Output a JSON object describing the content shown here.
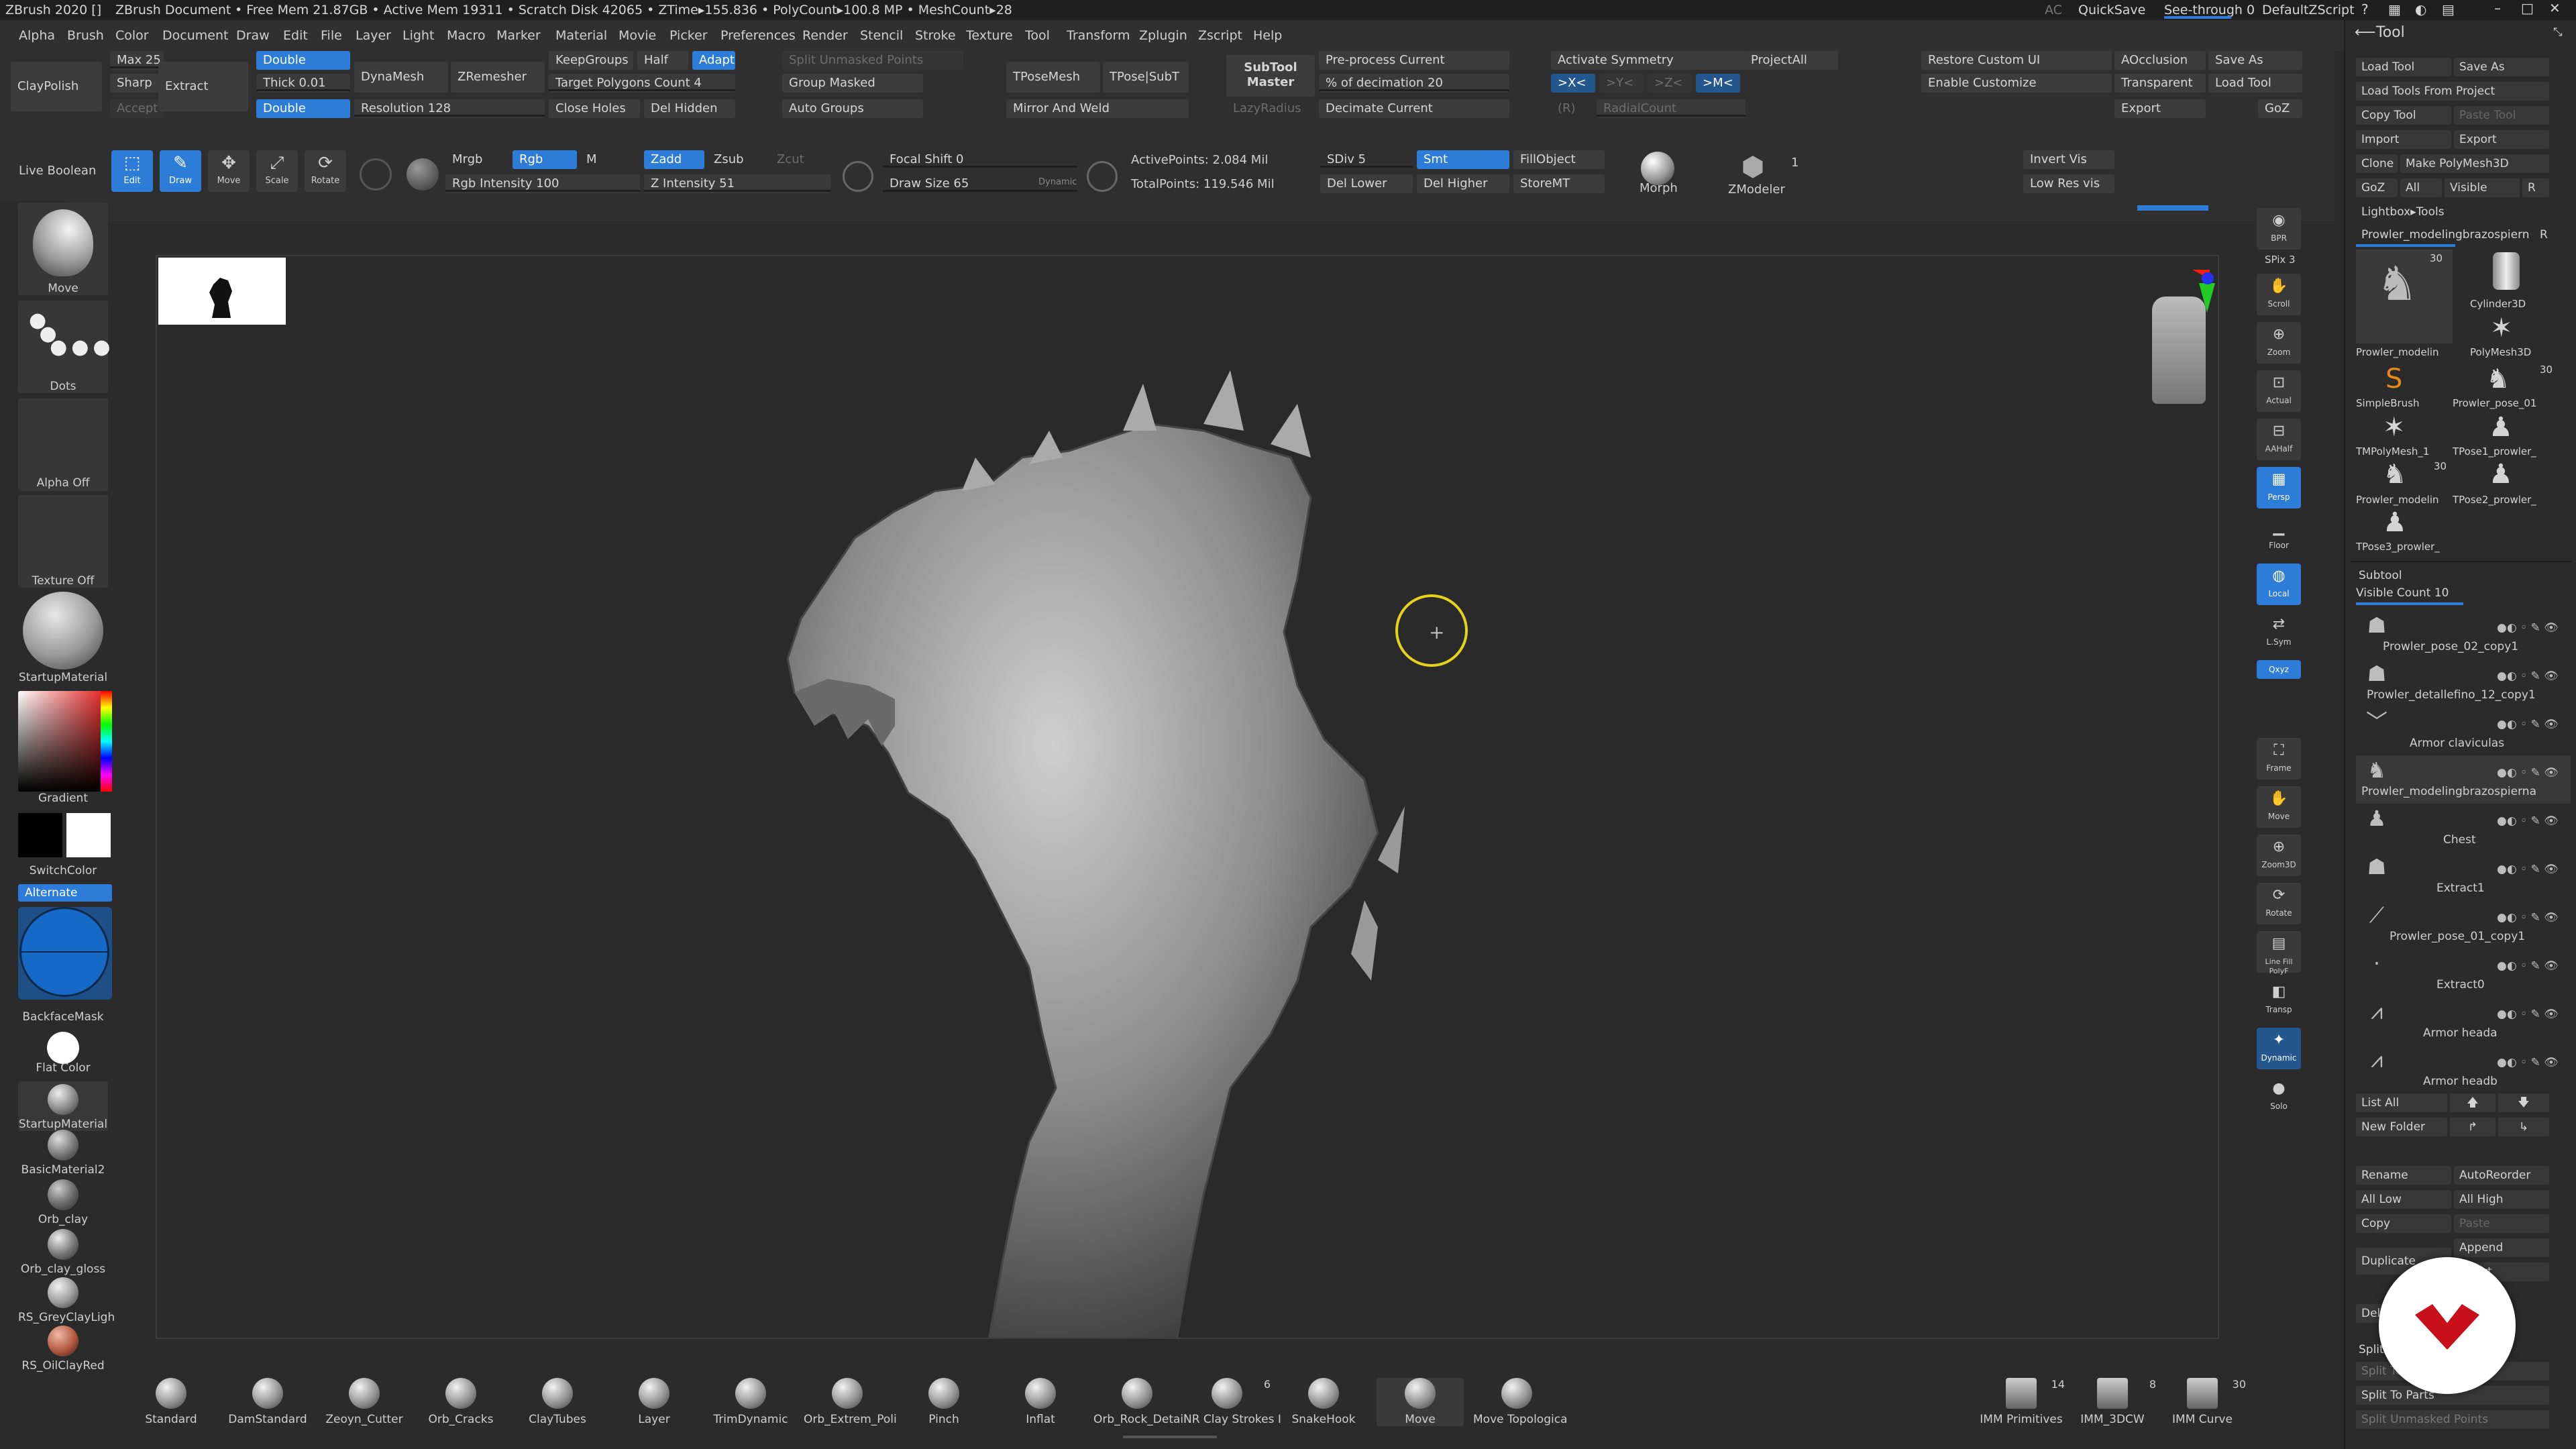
{
  "titlebar": {
    "app": "ZBrush 2020 []",
    "document": "ZBrush Document",
    "stats": "• Free Mem 21.87GB • Active Mem 19311 • Scratch Disk 42065 • ZTime▸155.836 • PolyCount▸100.8 MP • MeshCount▸28",
    "ac": "AC",
    "quicksave": "QuickSave",
    "seethrough": "See-through  0",
    "script": "DefaultZScript"
  },
  "menus": [
    "Alpha",
    "Brush",
    "Color",
    "Document",
    "Draw",
    "Edit",
    "File",
    "Layer",
    "Light",
    "Macro",
    "Marker",
    "Material",
    "Movie",
    "Picker",
    "Preferences",
    "Render",
    "Stencil",
    "Stroke",
    "Texture",
    "Tool",
    "Transform",
    "Zplugin",
    "Zscript",
    "Help"
  ],
  "toolbar": {
    "claypolish": "ClayPolish",
    "max": "Max 25",
    "sharp": "Sharp",
    "accept": "Accept",
    "extract": "Extract",
    "double1": "Double",
    "thick": "Thick 0.01",
    "double2": "Double",
    "dynamesh": "DynaMesh",
    "resolution": "Resolution 128",
    "zremesher": "ZRemesher",
    "keepgroups": "KeepGroups",
    "half": "Half",
    "adapt": "Adapt",
    "target_polygons": "Target Polygons Count 4",
    "close_holes": "Close Holes",
    "del_hidden": "Del Hidden",
    "split_unmasked": "Split Unmasked Points",
    "group_masked": "Group Masked",
    "auto_groups": "Auto Groups",
    "tposemesh": "TPoseMesh",
    "tpose_subt": "TPose|SubT",
    "mirror_weld": "Mirror And Weld",
    "subtool_master": "SubTool Master",
    "lazyradius": "LazyRadius",
    "preprocess": "Pre-process Current",
    "decimation": "% of decimation 20",
    "decimate_current": "Decimate Current",
    "activate_symmetry": "Activate Symmetry",
    "sym_x": ">X<",
    "sym_y": ">Y<",
    "sym_z": ">Z<",
    "sym_m": ">M<",
    "sym_r": "(R)",
    "radialcount": "RadialCount",
    "projectall": "ProjectAll",
    "restore_custom_ui": "Restore Custom UI",
    "enable_customize": "Enable Customize",
    "aocclusion": "AOcclusion",
    "transparent": "Transparent",
    "export": "Export",
    "save_as": "Save As",
    "load_tool": "Load Tool",
    "goz": "GoZ",
    "live_boolean": "Live Boolean",
    "edit": "Edit",
    "draw": "Draw",
    "move": "Move",
    "scale": "Scale",
    "rotate": "Rotate",
    "mrgb": "Mrgb",
    "rgb": "Rgb",
    "m": "M",
    "rgb_intensity": "Rgb Intensity 100",
    "zadd": "Zadd",
    "zsub": "Zsub",
    "zcut": "Zcut",
    "z_intensity": "Z Intensity 51",
    "focal_shift": "Focal Shift 0",
    "draw_size": "Draw Size 65",
    "dynamic": "Dynamic",
    "active_points": "ActivePoints: 2.084 Mil",
    "total_points": "TotalPoints: 119.546 Mil",
    "sdiv": "SDiv 5",
    "smt": "Smt",
    "fillobject": "FillObject",
    "del_lower": "Del Lower",
    "del_higher": "Del Higher",
    "storemt": "StoreMT",
    "morph": "Morph",
    "zmodeler": "ZModeler",
    "zmodeler_count": "1",
    "invert_vis": "Invert Vis",
    "low_res_vis": "Low Res vis"
  },
  "left_shelf": {
    "brush": "Move",
    "stroke": "Dots",
    "alpha": "Alpha Off",
    "texture": "Texture Off",
    "material": "StartupMaterial",
    "gradient": "Gradient",
    "switchcolor": "SwitchColor",
    "alternate": "Alternate",
    "backfacemask": "BackfaceMask",
    "flatcolor": "Flat Color",
    "materials": [
      "StartupMaterial",
      "BasicMaterial2",
      "Orb_clay",
      "Orb_clay_gloss",
      "RS_GreyClayLigh",
      "RS_OilClayRed"
    ]
  },
  "right_shelf": [
    "BPR",
    "SPix 3",
    "Scroll",
    "Zoom",
    "Actual",
    "AAHalf",
    "Persp",
    "Floor",
    "Local",
    "L.Sym",
    "Qxyz",
    "Frame",
    "Move",
    "Zoom3D",
    "Rotate",
    "Line Fill PolyF",
    "Transp",
    "Dynamic",
    "Solo"
  ],
  "tool_panel": {
    "title": "Tool",
    "load_tool": "Load Tool",
    "save_as": "Save As",
    "load_from_project": "Load Tools From Project",
    "copy_tool": "Copy Tool",
    "paste_tool": "Paste Tool",
    "import": "Import",
    "export": "Export",
    "clone": "Clone",
    "make_polymesh": "Make PolyMesh3D",
    "goz": "GoZ",
    "all": "All",
    "visible": "Visible",
    "r": "R",
    "lightbox_tools": "Lightbox▸Tools",
    "current_tool": "Prowler_modelingbrazospiern",
    "current_tool_count": "R",
    "tools": [
      {
        "name": "Prowler_modelin",
        "count": "30"
      },
      {
        "name": "Cylinder3D",
        "count": ""
      },
      {
        "name": "PolyMesh3D",
        "count": ""
      },
      {
        "name": "SimpleBrush",
        "count": ""
      },
      {
        "name": "Prowler_pose_01",
        "count": "30"
      },
      {
        "name": "TMPolyMesh_1",
        "count": ""
      },
      {
        "name": "TPose1_prowler_",
        "count": ""
      },
      {
        "name": "Prowler_modelin",
        "count": "30"
      },
      {
        "name": "TPose2_prowler_",
        "count": ""
      },
      {
        "name": "TPose3_prowler_",
        "count": ""
      }
    ],
    "subtool": "Subtool",
    "visible_count": "Visible Count 10",
    "subtools": [
      "Prowler_pose_02_copy1",
      "Prowler_detallefino_12_copy1",
      "Armor claviculas",
      "Prowler_modelingbrazospierna",
      "Chest",
      "Extract1",
      "Prowler_pose_01_copy1",
      "Extract0",
      "Armor heada",
      "Armor headb"
    ],
    "list_all": "List All",
    "new_folder": "New Folder",
    "rename": "Rename",
    "autoreorder": "AutoReorder",
    "all_low": "All Low",
    "all_high": "All High",
    "copy": "Copy",
    "paste": "Paste",
    "append": "Append",
    "duplicate": "Duplicate",
    "insert": "Insert",
    "delete": "Delete",
    "split": "Split",
    "split_to_similar": "Split To Similar Parts",
    "split_to_parts": "Split To Parts",
    "split_unmasked": "Split Unmasked Points"
  },
  "bottom_shelf": {
    "brushes": [
      {
        "name": "Standard",
        "count": ""
      },
      {
        "name": "DamStandard",
        "count": ""
      },
      {
        "name": "Zeoyn_Cutter",
        "count": ""
      },
      {
        "name": "Orb_Cracks",
        "count": ""
      },
      {
        "name": "ClayTubes",
        "count": ""
      },
      {
        "name": "Layer",
        "count": ""
      },
      {
        "name": "TrimDynamic",
        "count": ""
      },
      {
        "name": "Orb_Extrem_Poli",
        "count": ""
      },
      {
        "name": "Pinch",
        "count": ""
      },
      {
        "name": "Inflat",
        "count": ""
      },
      {
        "name": "Orb_Rock_Detail",
        "count": ""
      },
      {
        "name": "NR Clay Strokes I",
        "count": "6"
      },
      {
        "name": "SnakeHook",
        "count": ""
      },
      {
        "name": "Move",
        "count": ""
      },
      {
        "name": "Move Topologica",
        "count": ""
      }
    ],
    "right": [
      {
        "name": "IMM Primitives",
        "count": "14"
      },
      {
        "name": "IMM_3DCW",
        "count": "8"
      },
      {
        "name": "IMM Curve",
        "count": "30"
      }
    ]
  }
}
